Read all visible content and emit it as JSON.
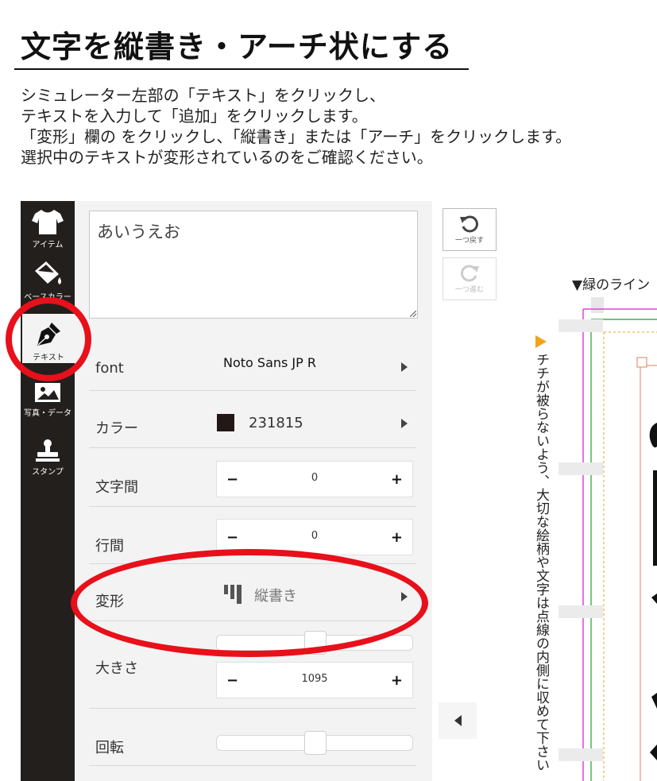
{
  "title": "文字を縦書き・アーチ状にする",
  "instructions": [
    "シミュレーター左部の「テキスト」をクリックし、",
    "テキストを入力して「追加」をクリックします。",
    "「変形」欄の をクリックし、「縦書き」または「アーチ」をクリックします。",
    "選択中のテキストが変形されているのをご確認ください。"
  ],
  "sidebar": {
    "items": [
      {
        "label": "アイテム",
        "icon": "tshirt-icon"
      },
      {
        "label": "ベースカラー",
        "icon": "paint-bucket-icon"
      },
      {
        "label": "テキスト",
        "icon": "pen-nib-icon",
        "active": true
      },
      {
        "label": "写真・データ",
        "icon": "image-icon"
      },
      {
        "label": "スタンプ",
        "icon": "stamp-icon"
      }
    ]
  },
  "editor": {
    "text_value": "あいうえお",
    "font": {
      "label": "font",
      "value": "Noto Sans JP R"
    },
    "color": {
      "label": "カラー",
      "value": "231815",
      "swatch": "#231815"
    },
    "letter_spacing": {
      "label": "文字間",
      "value": "0"
    },
    "line_spacing": {
      "label": "行間",
      "value": "0"
    },
    "transform": {
      "label": "変形",
      "value": "縦書き"
    },
    "size": {
      "label": "大きさ",
      "value": "1095",
      "slider_fraction": 0.5
    },
    "rotation": {
      "label": "回転",
      "slider_fraction": 0.5
    },
    "stepper_minus": "−",
    "stepper_plus": "+"
  },
  "history": {
    "undo_label": "一つ戻す",
    "redo_label": "一つ進む"
  },
  "canvas": {
    "green_line_label": "▼緑のライン",
    "note_vertical": "チチが被らないよう、大切な絵柄や文字は点線の内側に収めて下さい"
  },
  "colors": {
    "sidebar_bg": "#231f1d",
    "highlight_ring": "#e8101a",
    "guide_green": "#1a9c3a",
    "guide_magenta": "#e040e0",
    "guide_orange": "#f2a21b"
  }
}
